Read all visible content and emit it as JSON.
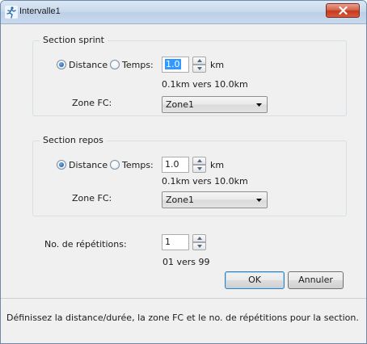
{
  "window": {
    "title": "Intervalle1"
  },
  "sprint": {
    "legend": "Section sprint",
    "radio_distance": "Distance",
    "radio_time": "Temps:",
    "value": "1.0",
    "unit": "km",
    "range": "0.1km vers 10.0km",
    "zone_label": "Zone FC:",
    "zone_value": "Zone1"
  },
  "rest": {
    "legend": "Section repos",
    "radio_distance": "Distance",
    "radio_time": "Temps:",
    "value": "1.0",
    "unit": "km",
    "range": "0.1km vers 10.0km",
    "zone_label": "Zone FC:",
    "zone_value": "Zone1"
  },
  "repetitions": {
    "label": "No. de répétitions:",
    "value": "1",
    "range": "01 vers 99"
  },
  "buttons": {
    "ok": "OK",
    "cancel": "Annuler"
  },
  "status": {
    "text": "Définissez la distance/durée, la zone FC et le no. de répétitions pour la section."
  }
}
